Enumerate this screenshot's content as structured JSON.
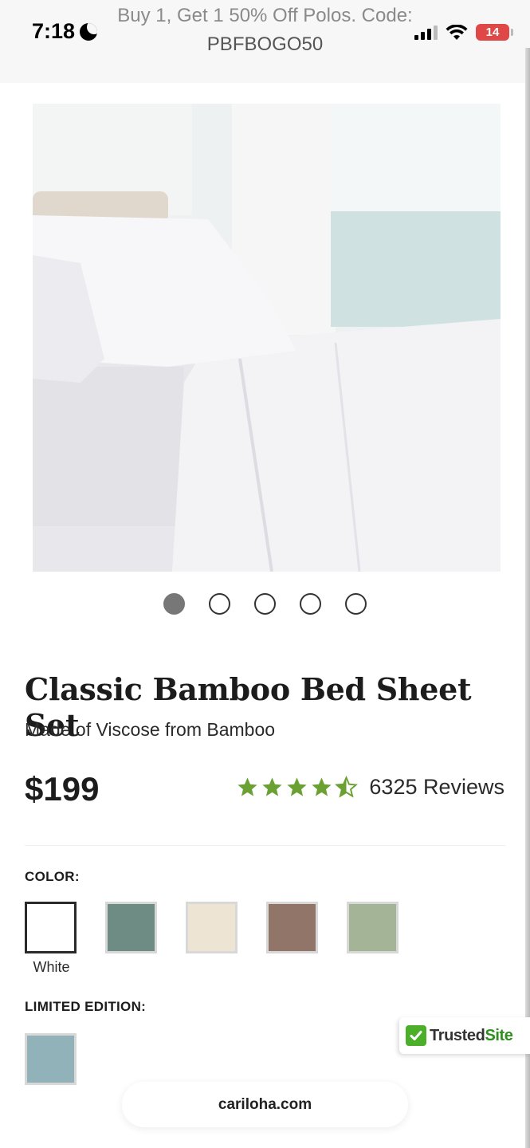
{
  "status_bar": {
    "time": "7:18",
    "battery": "14"
  },
  "promo": {
    "line1": "Buy 1, Get 1 50% Off Polos. Code:",
    "line2": "PBFBOGO50"
  },
  "product": {
    "title": "Classic Bamboo Bed Sheet Set",
    "subtitle": "Made of Viscose from Bamboo",
    "price": "$199",
    "rating": 4.5,
    "reviews": "6325 Reviews"
  },
  "carousel": {
    "count": 5,
    "active_index": 0
  },
  "color_section": {
    "label": "COLOR:",
    "swatches": [
      {
        "name": "White",
        "color": "#ffffff",
        "selected": true
      },
      {
        "name": "",
        "color": "#6f8c84",
        "selected": false
      },
      {
        "name": "",
        "color": "#ede4d4",
        "selected": false
      },
      {
        "name": "",
        "color": "#917569",
        "selected": false
      },
      {
        "name": "",
        "color": "#a3b596",
        "selected": false
      }
    ],
    "selected_caption": "White"
  },
  "limited_section": {
    "label": "LIMITED EDITION:",
    "swatches": [
      {
        "color": "#91b2b8"
      }
    ]
  },
  "trusted_badge": {
    "part1": "Trusted",
    "part2": "Site"
  },
  "browser": {
    "url": "cariloha.com"
  },
  "colors": {
    "star": "#6ba133",
    "battery": "#e04848"
  }
}
